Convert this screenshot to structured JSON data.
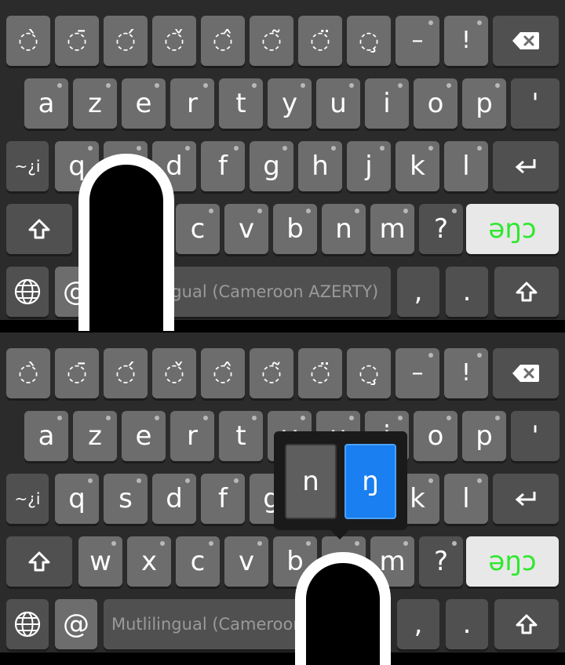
{
  "keyboard": {
    "diacritic_row": [
      "◌̀",
      "◌̄",
      "◌́",
      "◌̌",
      "◌̂",
      "◌̃",
      "◌̈",
      "◌̧",
      "–",
      "!"
    ],
    "row_azerty": [
      "a",
      "z",
      "e",
      "r",
      "t",
      "y",
      "u",
      "i",
      "o",
      "p",
      "'"
    ],
    "row_home": [
      "q",
      "s",
      "d",
      "f",
      "g",
      "h",
      "j",
      "k",
      "l"
    ],
    "row_bottom_letters": [
      "w",
      "x",
      "c",
      "v",
      "b",
      "n",
      "m",
      "?"
    ],
    "symbols_key": "~¿i",
    "language_switch_key": "əŋɔ",
    "at_key": "@",
    "comma_key": ",",
    "period_key": ".",
    "space_top": "Mutlilingual (Cameroon AZERTY)",
    "space_bottom": "Mutlilingual (Cameroon AZERTY)",
    "icons": {
      "backspace": "backspace-icon",
      "enter": "enter-icon",
      "shift": "shift-icon",
      "globe": "globe-icon"
    },
    "colors": {
      "key": "#6d6d6d",
      "key_dark": "#505050",
      "background": "#2b2b2b",
      "language_text": "#2ee82e",
      "popup_selected": "#1a7ff0"
    }
  },
  "popup": {
    "options": [
      "n",
      "ŋ"
    ],
    "selected": "ŋ"
  }
}
